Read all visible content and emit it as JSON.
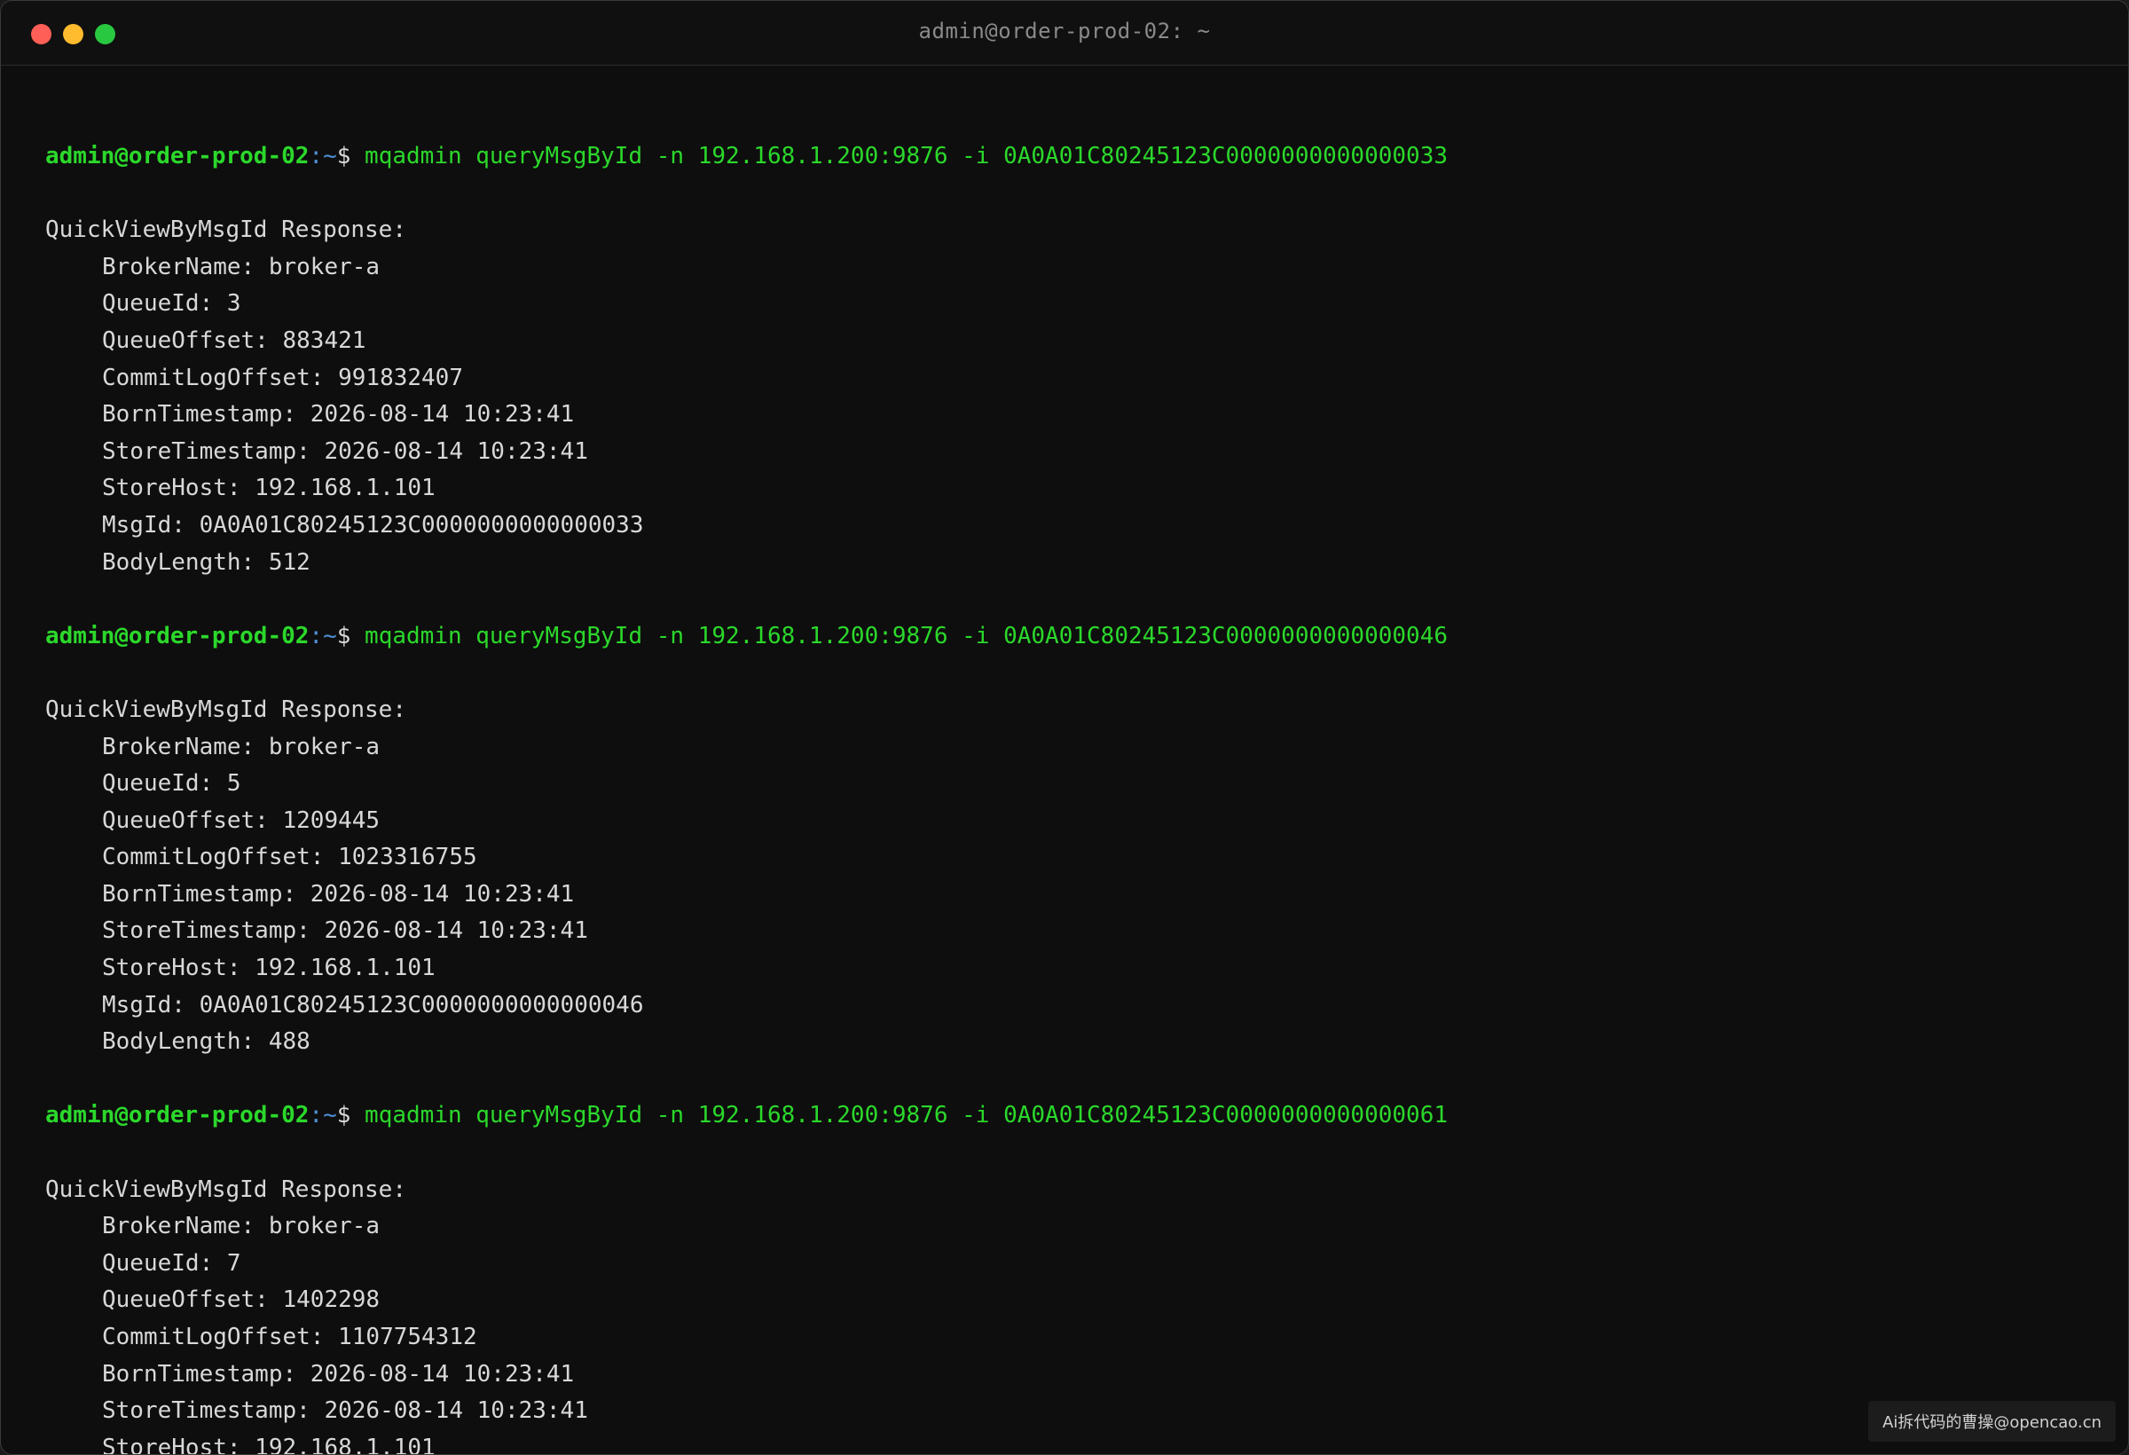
{
  "window": {
    "title": "admin@order-prod-02: ~"
  },
  "prompt": {
    "user_host": "admin@order-prod-02",
    "path": ":~",
    "symbol": "$ "
  },
  "blocks": [
    {
      "command": "mqadmin queryMsgById -n 192.168.1.200:9876 -i 0A0A01C80245123C0000000000000033",
      "header": "QuickViewByMsgId Response:",
      "fields": [
        "BrokerName: broker-a",
        "QueueId: 3",
        "QueueOffset: 883421",
        "CommitLogOffset: 991832407",
        "BornTimestamp: 2026-08-14 10:23:41",
        "StoreTimestamp: 2026-08-14 10:23:41",
        "StoreHost: 192.168.1.101",
        "MsgId: 0A0A01C80245123C0000000000000033",
        "BodyLength: 512"
      ]
    },
    {
      "command": "mqadmin queryMsgById -n 192.168.1.200:9876 -i 0A0A01C80245123C0000000000000046",
      "header": "QuickViewByMsgId Response:",
      "fields": [
        "BrokerName: broker-a",
        "QueueId: 5",
        "QueueOffset: 1209445",
        "CommitLogOffset: 1023316755",
        "BornTimestamp: 2026-08-14 10:23:41",
        "StoreTimestamp: 2026-08-14 10:23:41",
        "StoreHost: 192.168.1.101",
        "MsgId: 0A0A01C80245123C0000000000000046",
        "BodyLength: 488"
      ]
    },
    {
      "command": "mqadmin queryMsgById -n 192.168.1.200:9876 -i 0A0A01C80245123C0000000000000061",
      "header": "QuickViewByMsgId Response:",
      "fields": [
        "BrokerName: broker-a",
        "QueueId: 7",
        "QueueOffset: 1402298",
        "CommitLogOffset: 1107754312",
        "BornTimestamp: 2026-08-14 10:23:41",
        "StoreTimestamp: 2026-08-14 10:23:41",
        "StoreHost: 192.168.1.101"
      ]
    }
  ],
  "watermark": "Ai拆代码的曹操@opencao.cn"
}
